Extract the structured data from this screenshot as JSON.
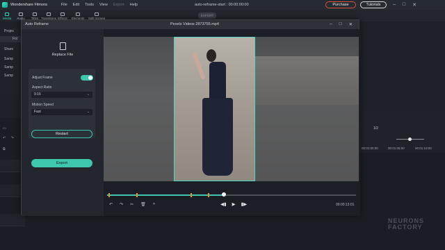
{
  "app": {
    "name": "Wondershare Filmora",
    "menu": [
      "File",
      "Edit",
      "Tools",
      "View",
      "Export",
      "Help"
    ],
    "document_title": "auto-reframe-start : 00:00:00:00",
    "purchase_label": "Purchase",
    "tutorials_label": "Tutorials",
    "export_label": "EXPORT"
  },
  "tabs": [
    {
      "label": "Media",
      "active": true
    },
    {
      "label": "Audio",
      "active": false
    },
    {
      "label": "Titles",
      "active": false
    },
    {
      "label": "Transitions",
      "active": false
    },
    {
      "label": "Effects",
      "active": false
    },
    {
      "label": "Elements",
      "active": false
    },
    {
      "label": "Split Screen",
      "active": false
    }
  ],
  "left_panel": {
    "items": [
      "Projec",
      "Fol",
      "Share",
      "Samp",
      "Samp",
      "Samp"
    ]
  },
  "right_panel": {
    "ratio": "1/2",
    "times": [
      "00:01:00:00",
      "00:01:05:00",
      "00:01:10:00"
    ]
  },
  "dialog": {
    "title": "Auto Reframe",
    "file_name": "Pexels Videos 2873755.mp4",
    "replace_label": "Replace File",
    "adjust_frame_label": "Adjust Frame",
    "adjust_frame_on": true,
    "aspect_ratio_label": "Aspect Ratio",
    "aspect_ratio_value": "9:16",
    "motion_speed_label": "Motion Speed",
    "motion_speed_value": "Fast",
    "restart_label": "Restart",
    "export_label": "Export",
    "timecode": "00:00:13:01",
    "progress": 0.47
  },
  "watermark": {
    "line1": "NEURONS",
    "line2": "FACTORY"
  },
  "colors": {
    "accent": "#3fc7ad",
    "keyframe": "#e0913a",
    "purchase_border": "#e0513f"
  }
}
